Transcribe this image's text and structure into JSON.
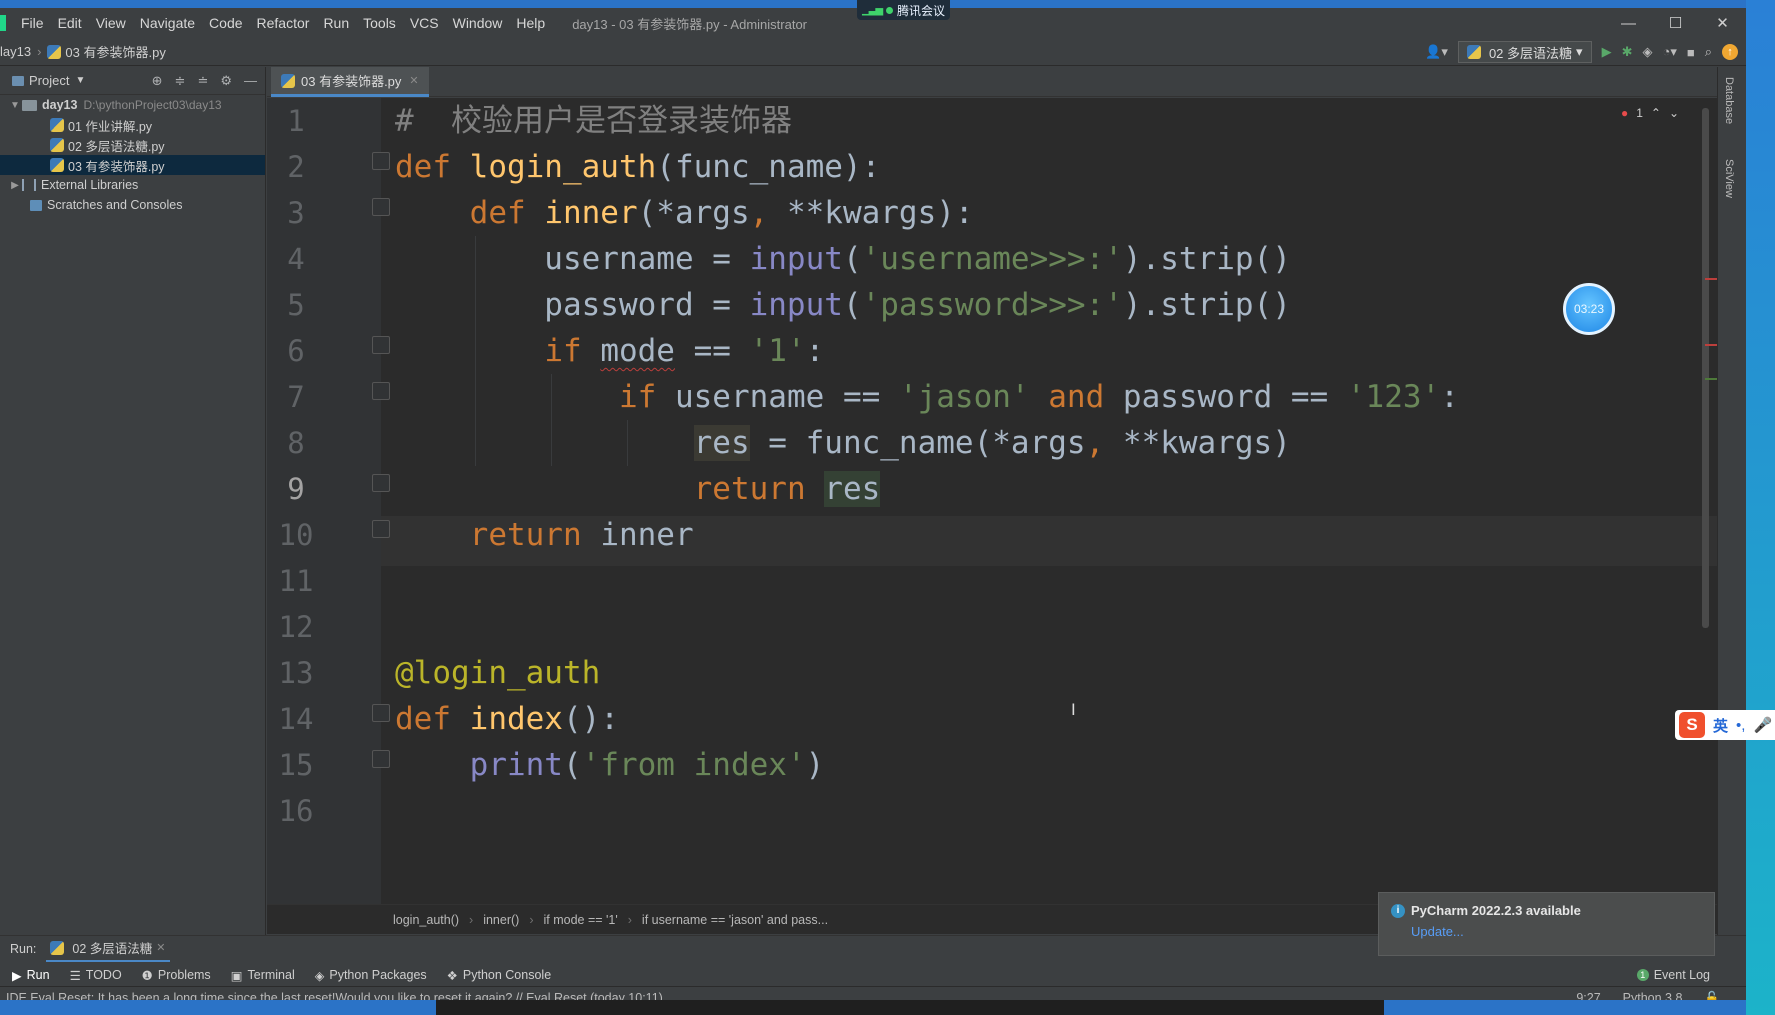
{
  "meeting": {
    "label": "腾讯会议"
  },
  "menu": {
    "items": [
      "File",
      "Edit",
      "View",
      "Navigate",
      "Code",
      "Refactor",
      "Run",
      "Tools",
      "VCS",
      "Window",
      "Help"
    ]
  },
  "window_title": "day13 - 03 有参装饰器.py - Administrator",
  "window_controls": {
    "minimize": "—",
    "maximize": "☐",
    "close": "✕"
  },
  "nav": {
    "crumb_root": "lay13",
    "crumb_file": "03 有参装饰器.py"
  },
  "run_config": {
    "label": "02 多层语法糖"
  },
  "project": {
    "header": "Project",
    "root": {
      "name": "day13",
      "path": "D:\\pythonProject03\\day13"
    },
    "files": [
      "01 作业讲解.py",
      "02 多层语法糖.py",
      "03 有参装饰器.py"
    ],
    "external": "External Libraries",
    "scratches": "Scratches and Consoles"
  },
  "editor_tab": {
    "label": "03 有参装饰器.py"
  },
  "editor": {
    "line_numbers": [
      "1",
      "2",
      "3",
      "4",
      "5",
      "6",
      "7",
      "8",
      "9",
      "10",
      "11",
      "12",
      "13",
      "14",
      "15",
      "16"
    ],
    "current_line": "9",
    "error_count": "1"
  },
  "timer": {
    "label": "03:23"
  },
  "ime": {
    "lang": "英",
    "punct": "•,"
  },
  "breadcrumb": [
    "login_auth()",
    "inner()",
    "if mode == '1'",
    "if username == 'jason' and pass..."
  ],
  "notification": {
    "title": "PyCharm 2022.2.3 available",
    "link": "Update..."
  },
  "runbar": {
    "label": "Run:",
    "tab": "02 多层语法糖"
  },
  "tool_windows": [
    "Run",
    "TODO",
    "Problems",
    "Terminal",
    "Python Packages",
    "Python Console"
  ],
  "event_log": "Event Log",
  "status": {
    "message": "IDE Eval Reset: It has been a long time since the last reset!Would you like to reset it again? // Eval Reset (today 10:11)",
    "position": "9:27",
    "interpreter": "Python 3.8"
  },
  "right_tools": [
    "Database",
    "SciView"
  ],
  "colors": {
    "keyword": "#cc7832",
    "function": "#ffc66d",
    "builtin": "#8888c6",
    "string": "#6a8759",
    "comment": "#808080",
    "decorator": "#bbb529",
    "accent": "#4a88c7"
  }
}
